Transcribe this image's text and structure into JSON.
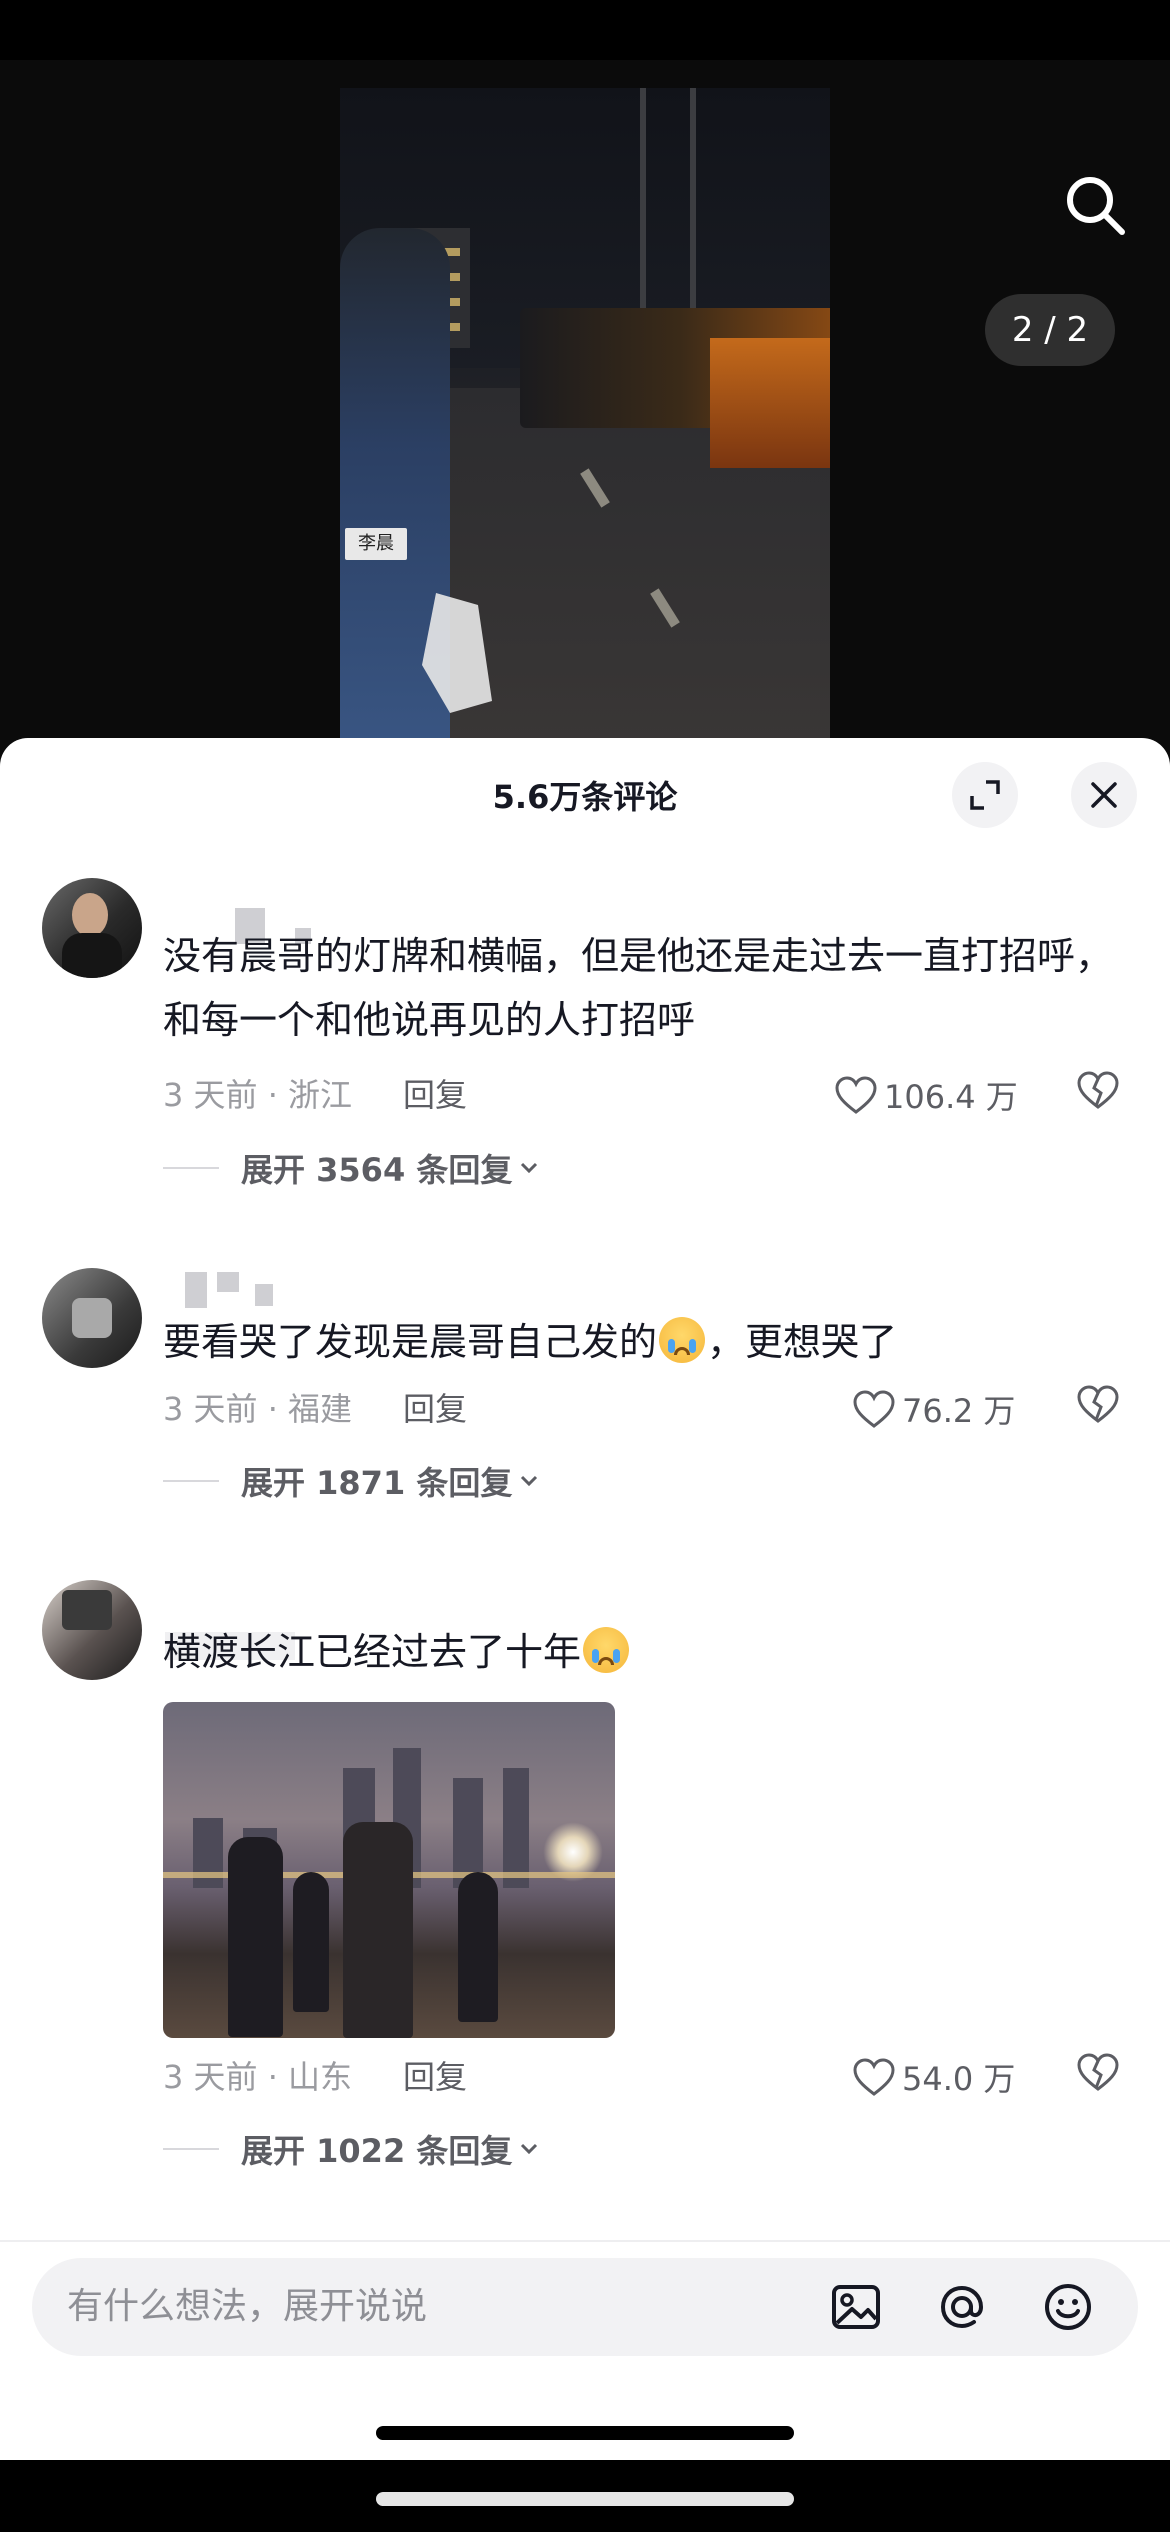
{
  "video": {
    "page_indicator": "2 / 2",
    "sign_text": "李晨"
  },
  "comments_sheet": {
    "title": "5.6万条评论",
    "comments": [
      {
        "text": "没有晨哥的灯牌和横幅，但是他还是走过去一直打招呼，和每一个和他说再见的人打招呼",
        "time_location": "3 天前 · 浙江",
        "reply_label": "回复",
        "likes": "106.4 万",
        "expand_replies": "展开 3564 条回复"
      },
      {
        "text_before_emoji": "要看哭了发现是晨哥自己发的",
        "text_after_emoji": "，更想哭了",
        "time_location": "3 天前 · 福建",
        "reply_label": "回复",
        "likes": "76.2 万",
        "expand_replies": "展开 1871 条回复"
      },
      {
        "text_before_emoji": "横渡长江已经过去了十年",
        "time_location": "3 天前 · 山东",
        "reply_label": "回复",
        "likes": "54.0 万",
        "expand_replies": "展开 1022 条回复"
      }
    ]
  },
  "input": {
    "placeholder": "有什么想法，展开说说"
  },
  "icons": [
    "search-icon",
    "expand-icon",
    "close-icon",
    "heart-icon",
    "broken-heart-icon",
    "chevron-down-icon",
    "image-icon",
    "at-icon",
    "emoji-icon",
    "crying-emoji-icon"
  ]
}
